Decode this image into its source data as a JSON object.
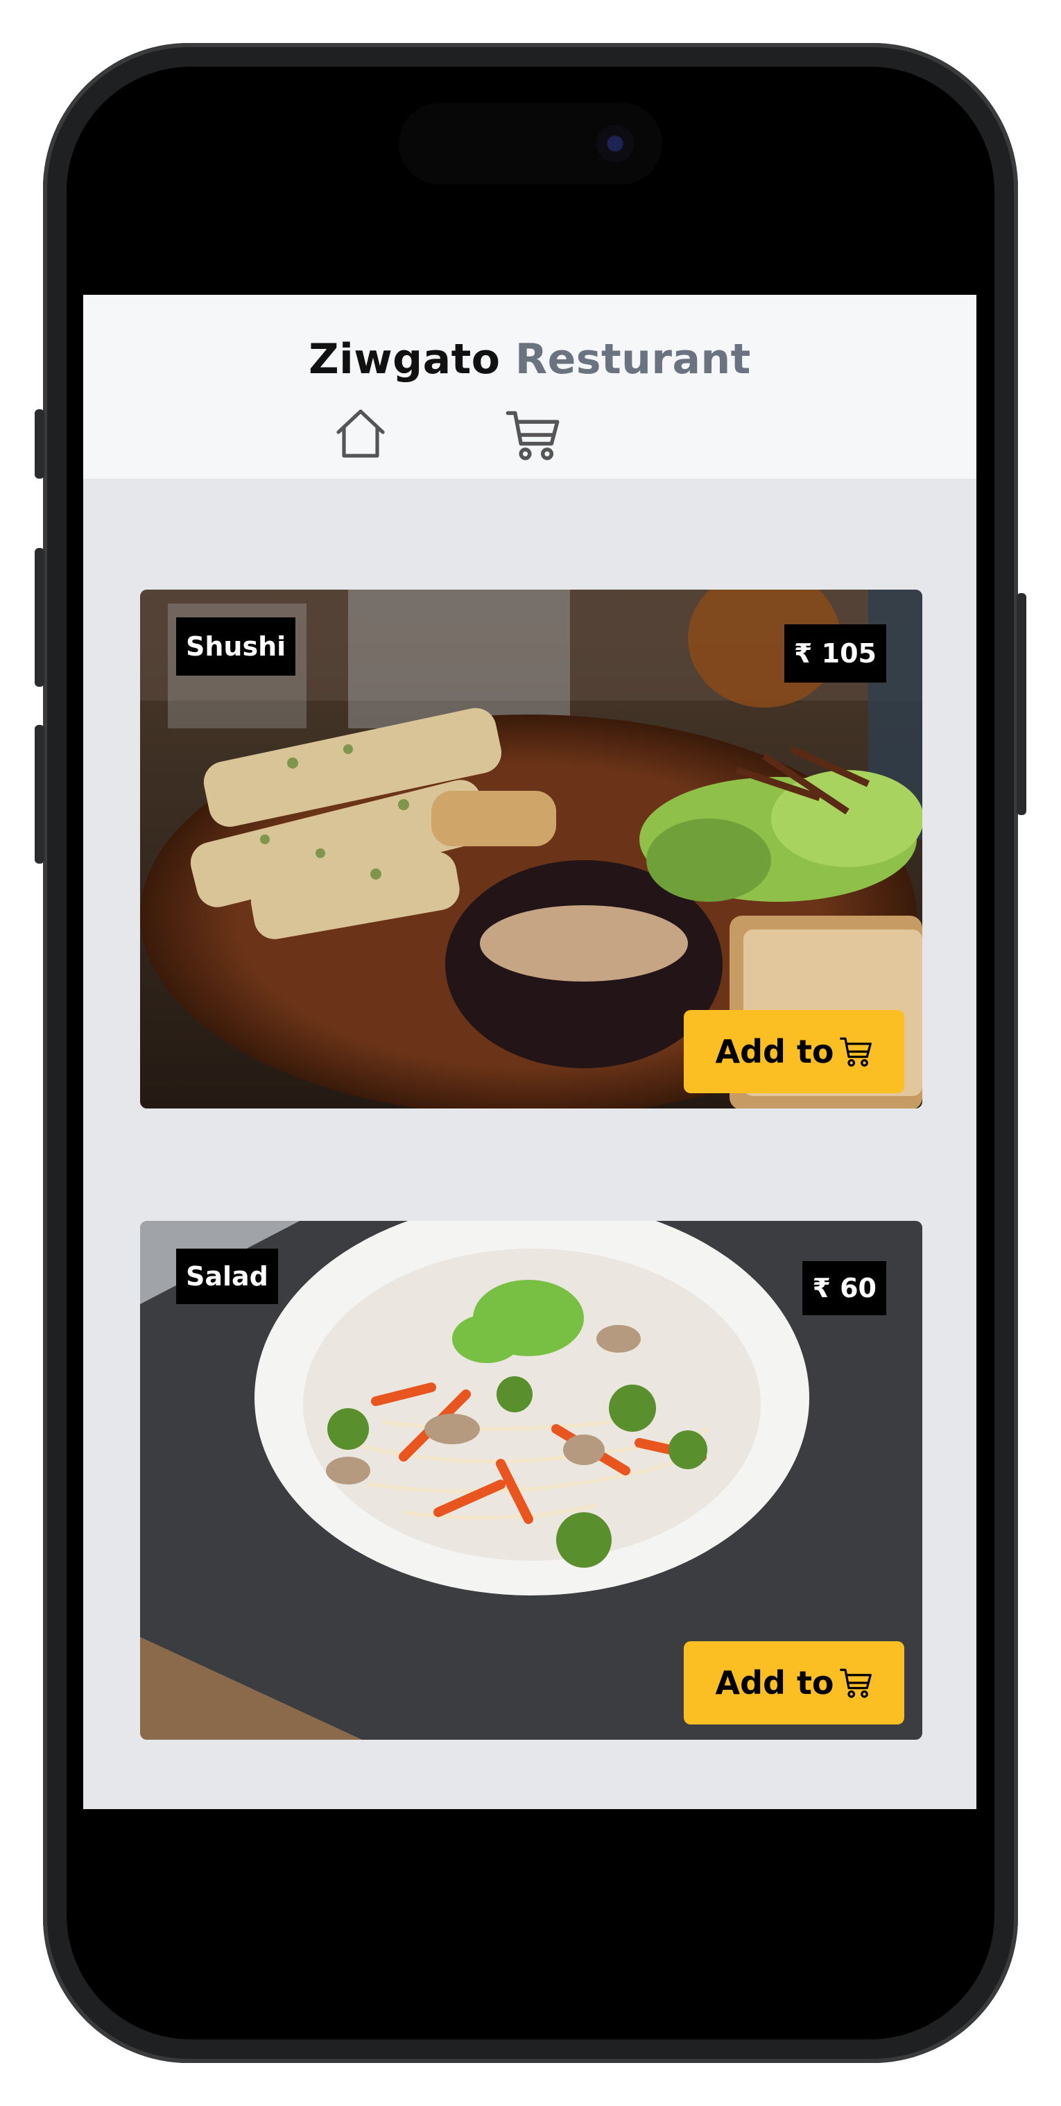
{
  "app": {
    "brand_primary": "Ziwgato",
    "brand_secondary": "Resturant",
    "nav": [
      {
        "icon": "home-icon"
      },
      {
        "icon": "cart-icon"
      }
    ]
  },
  "menu": {
    "items": [
      {
        "name": "Shushi",
        "price": "₹ 105",
        "button_label": "Add to",
        "button_icon": "cart-icon"
      },
      {
        "name": "Salad",
        "price": "₹ 60",
        "button_label": "Add to",
        "button_icon": "cart-icon"
      }
    ]
  },
  "colors": {
    "accent": "#fbbf24",
    "header_bg": "#f6f7f9",
    "screen_bg": "#e5e7eb",
    "brand_muted": "#6b7280"
  }
}
